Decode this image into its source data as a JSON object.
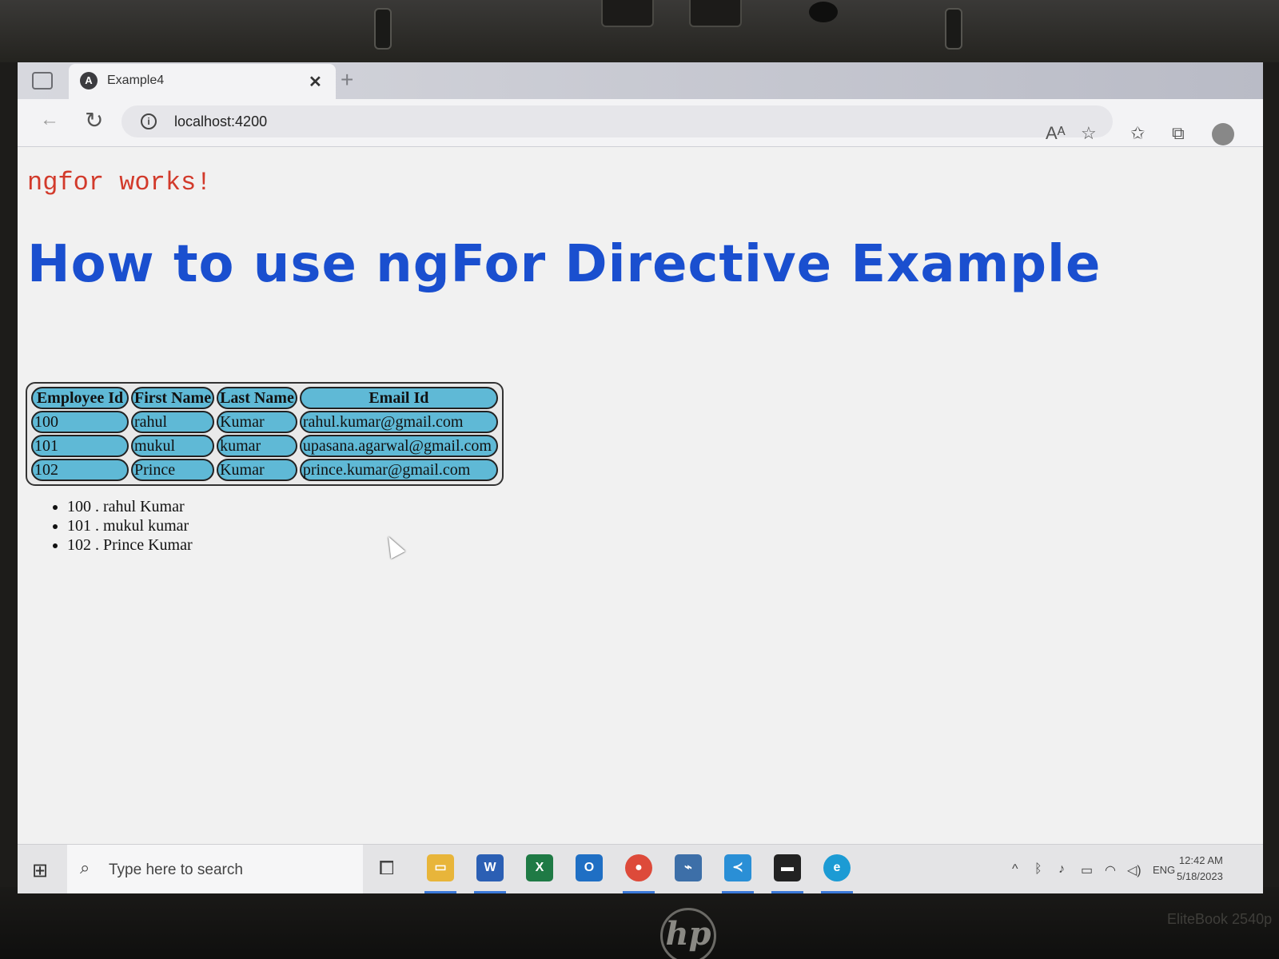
{
  "browser": {
    "tab_title": "Example4",
    "tab_favicon": "angular-icon",
    "tab_close": "✕",
    "new_tab": "+",
    "url": "localhost:4200",
    "info_glyph": "i"
  },
  "page": {
    "works_text": "ngfor works!",
    "heading": "How to use ngFor Directive Example",
    "table": {
      "headers": [
        "Employee Id",
        "First Name",
        "Last Name",
        "Email Id"
      ],
      "rows": [
        [
          "100",
          "rahul",
          "Kumar",
          "rahul.kumar@gmail.com"
        ],
        [
          "101",
          "mukul",
          "kumar",
          "upasana.agarwal@gmail.com"
        ],
        [
          "102",
          "Prince",
          "Kumar",
          "prince.kumar@gmail.com"
        ]
      ]
    },
    "list": [
      "100 . rahul Kumar",
      "101 . mukul kumar",
      "102 . Prince Kumar"
    ],
    "colors": {
      "works": "#d23a2b",
      "heading": "#1a4fcf",
      "cell_bg": "#5fb9d6"
    }
  },
  "taskbar": {
    "search_placeholder": "Type here to search",
    "language": "ENG",
    "time": "12:42 AM",
    "date": "5/18/2023",
    "apps": [
      "file-explorer-icon",
      "word-icon",
      "excel-icon",
      "outlook-icon",
      "chrome-icon",
      "workbench-icon",
      "vscode-icon",
      "terminal-icon",
      "edge-icon"
    ]
  },
  "device": {
    "brand": "hp",
    "model": "EliteBook 2540p"
  }
}
